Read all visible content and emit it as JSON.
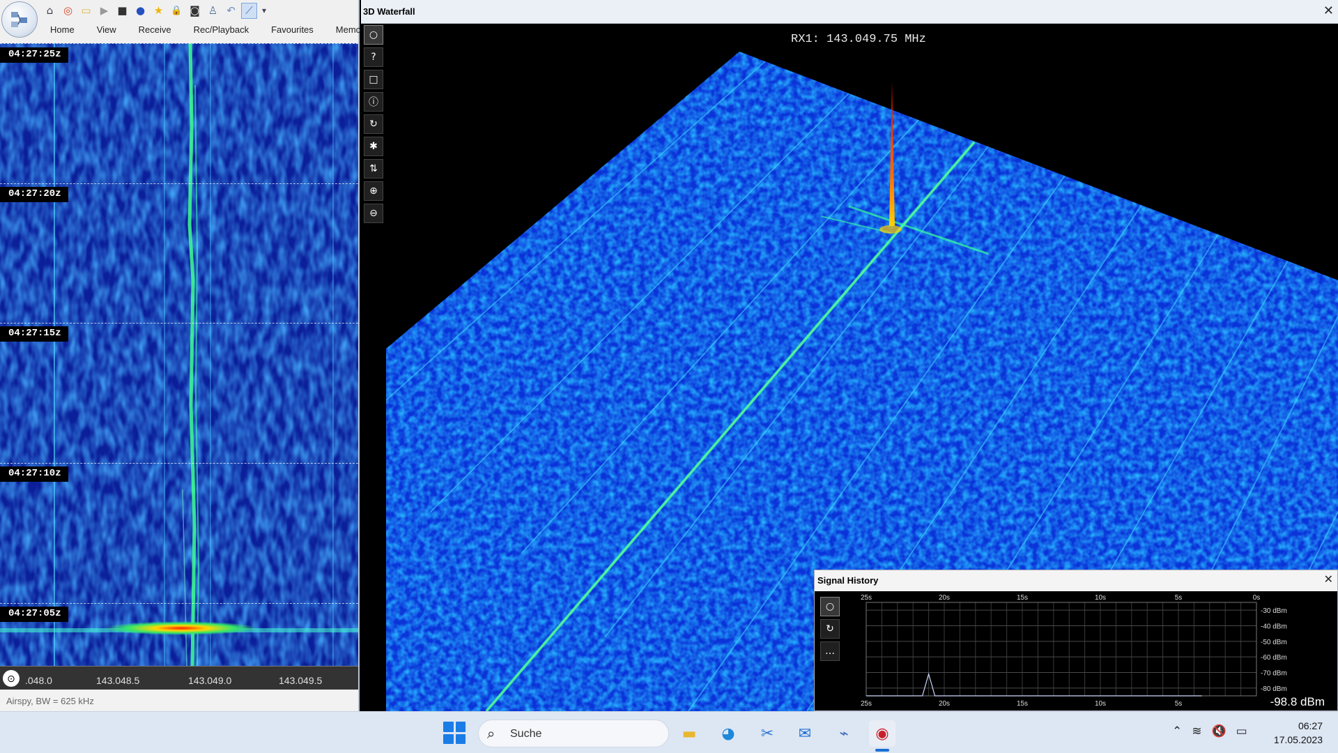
{
  "left_window": {
    "quick_toolbar": [
      {
        "icon": "home-icon",
        "glyph": "⌂"
      },
      {
        "icon": "lifebuoy-icon",
        "glyph": "◎"
      },
      {
        "icon": "folder-icon",
        "glyph": "▭"
      },
      {
        "icon": "play-icon",
        "glyph": "▶"
      },
      {
        "icon": "stop-icon",
        "glyph": "■"
      },
      {
        "icon": "record-icon",
        "glyph": "●"
      },
      {
        "icon": "star-icon",
        "glyph": "★"
      },
      {
        "icon": "lock-icon",
        "glyph": "🔒"
      },
      {
        "icon": "camera-icon",
        "glyph": "◙"
      },
      {
        "icon": "antenna-icon",
        "glyph": "♙"
      },
      {
        "icon": "undo-icon",
        "glyph": "↶"
      },
      {
        "icon": "chart-icon",
        "glyph": "⟋"
      },
      {
        "icon": "dropdown-icon",
        "glyph": "▾"
      }
    ],
    "ribbon_tabs": [
      "Home",
      "View",
      "Receive",
      "Rec/Playback",
      "Favourites",
      "Memor"
    ],
    "waterfall_times": [
      "04:27:25z",
      "04:27:20z",
      "04:27:15z",
      "04:27:10z",
      "04:27:05z"
    ],
    "freq_ticks": [
      ".048.0",
      "143.048.5",
      "143.049.0",
      "143.049.5"
    ],
    "status": "Airspy, BW = 625 kHz"
  },
  "waterfall_3d": {
    "title": "3D Waterfall",
    "close_glyph": "✕",
    "rx_readout": "RX1: 143.049.75 MHz",
    "tools": [
      {
        "icon": "circle-icon",
        "glyph": "○"
      },
      {
        "icon": "help-icon",
        "glyph": "?"
      },
      {
        "icon": "square-icon",
        "glyph": "□"
      },
      {
        "icon": "info-icon",
        "glyph": "ⓘ"
      },
      {
        "icon": "rotate-icon",
        "glyph": "↻"
      },
      {
        "icon": "asterisk-icon",
        "glyph": "✱"
      },
      {
        "icon": "updown-arrows-icon",
        "glyph": "⇅"
      },
      {
        "icon": "zoom-in-icon",
        "glyph": "⊕"
      },
      {
        "icon": "zoom-out-icon",
        "glyph": "⊖"
      }
    ]
  },
  "signal_history": {
    "title": "Signal History",
    "close_glyph": "✕",
    "tools": [
      {
        "icon": "circle-icon",
        "glyph": "○"
      },
      {
        "icon": "rotate-icon",
        "glyph": "↻"
      },
      {
        "icon": "more-icon",
        "glyph": "…"
      }
    ],
    "readout": "-98.8 dBm",
    "chart_data": {
      "type": "line",
      "x_ticks_top": [
        "25s",
        "20s",
        "15s",
        "10s",
        "5s",
        "0s"
      ],
      "x_ticks_bottom": [
        "25s",
        "20s",
        "15s",
        "10s",
        "5s"
      ],
      "y_ticks": [
        "-30 dBm",
        "-40 dBm",
        "-50 dBm",
        "-60 dBm",
        "-70 dBm",
        "-80 dBm"
      ],
      "ylim": [
        -85,
        -25
      ],
      "xlim": [
        25,
        0
      ],
      "series": [
        {
          "x": [
            25,
            22,
            21.4,
            21.2,
            21.0,
            20.8,
            20.6,
            20,
            15,
            10,
            5,
            3.5
          ],
          "values": [
            -85,
            -85,
            -85,
            -78,
            -71,
            -78,
            -85,
            -85,
            -85,
            -85,
            -85,
            -85
          ]
        }
      ]
    }
  },
  "taskbar": {
    "search_placeholder": "Suche",
    "apps": [
      {
        "icon": "file-explorer-icon",
        "glyph": "▬",
        "color": "#e8b630"
      },
      {
        "icon": "edge-browser-icon",
        "glyph": "◕",
        "color": "#1e88d8"
      },
      {
        "icon": "snipping-tool-icon",
        "glyph": "✂",
        "color": "#2b77d9"
      },
      {
        "icon": "mail-icon",
        "glyph": "✉",
        "color": "#1f6fd0"
      },
      {
        "icon": "sdr-app-icon",
        "glyph": "⌁",
        "color": "#3f6db8"
      },
      {
        "icon": "sdr-console-icon",
        "glyph": "◉",
        "color": "#c8202b"
      }
    ],
    "tray": [
      {
        "icon": "chevron-up-icon",
        "glyph": "⌃"
      },
      {
        "icon": "wifi-icon",
        "glyph": "≋"
      },
      {
        "icon": "speaker-muted-icon",
        "glyph": "🔇"
      },
      {
        "icon": "battery-icon",
        "glyph": "▭"
      }
    ],
    "time": "06:27",
    "date": "17.05.2023"
  }
}
